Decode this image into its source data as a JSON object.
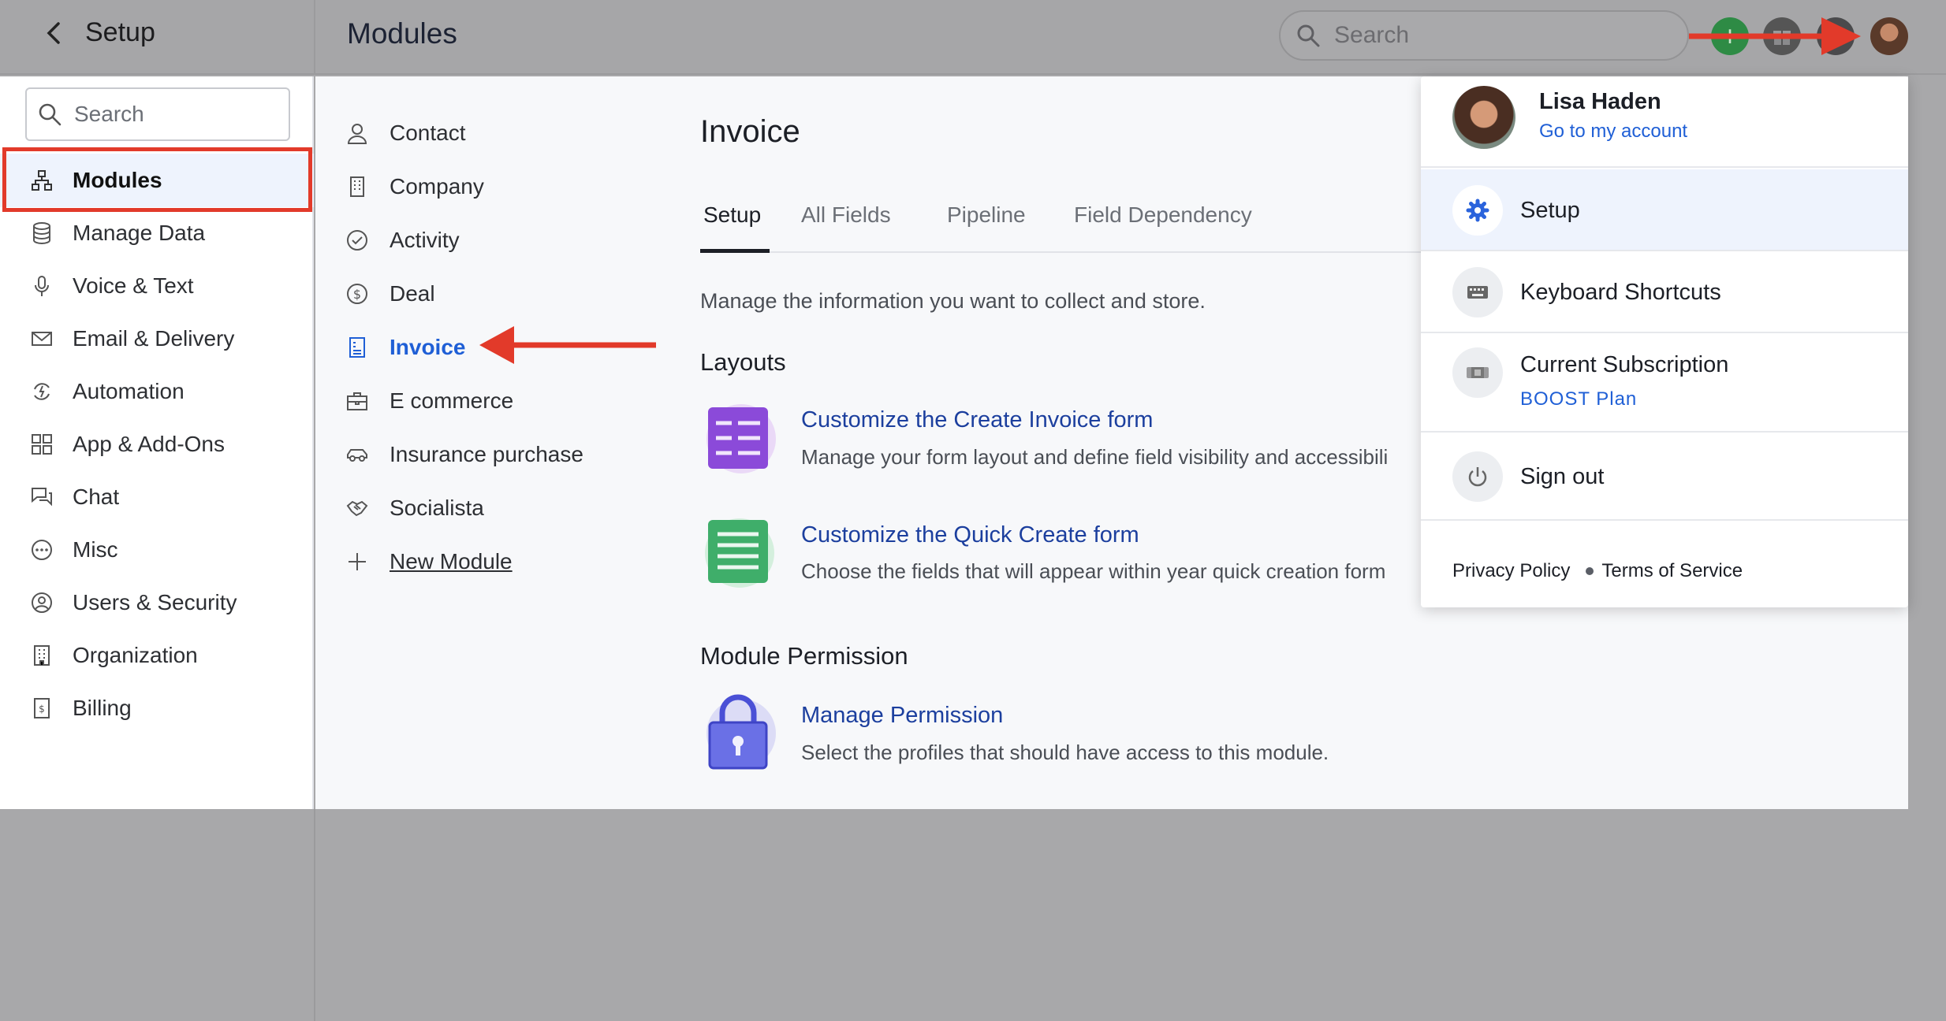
{
  "topbar": {
    "setup_title": "Setup",
    "modules_title": "Modules",
    "search_placeholder": "Search"
  },
  "sidebar": {
    "search_placeholder": "Search",
    "items": [
      {
        "label": "Modules",
        "icon": "sitemap-icon",
        "active": true
      },
      {
        "label": "Manage Data",
        "icon": "database-icon"
      },
      {
        "label": "Voice & Text",
        "icon": "microphone-icon"
      },
      {
        "label": "Email & Delivery",
        "icon": "envelope-icon"
      },
      {
        "label": "Automation",
        "icon": "automation-icon"
      },
      {
        "label": "App & Add-Ons",
        "icon": "grid-icon"
      },
      {
        "label": "Chat",
        "icon": "chat-icon"
      },
      {
        "label": "Misc",
        "icon": "ellipsis-icon"
      },
      {
        "label": "Users & Security",
        "icon": "user-circle-icon"
      },
      {
        "label": "Organization",
        "icon": "building-icon"
      },
      {
        "label": "Billing",
        "icon": "billing-icon"
      }
    ]
  },
  "modules": {
    "items": [
      {
        "label": "Contact",
        "icon": "person-icon"
      },
      {
        "label": "Company",
        "icon": "building-icon"
      },
      {
        "label": "Activity",
        "icon": "check-circle-icon"
      },
      {
        "label": "Deal",
        "icon": "dollar-circle-icon"
      },
      {
        "label": "Invoice",
        "icon": "invoice-icon",
        "active": true
      },
      {
        "label": "E commerce",
        "icon": "briefcase-icon"
      },
      {
        "label": "Insurance purchase",
        "icon": "car-icon"
      },
      {
        "label": "Socialista",
        "icon": "handshake-icon"
      }
    ],
    "new_module": "New Module"
  },
  "content": {
    "title": "Invoice",
    "tabs": [
      "Setup",
      "All Fields",
      "Pipeline",
      "Field Dependency"
    ],
    "active_tab": "Setup",
    "description": "Manage the information you want to collect and store.",
    "layouts_heading": "Layouts",
    "cards": [
      {
        "title": "Customize the Create Invoice form",
        "desc": "Manage your form layout and define field visibility and accessibili",
        "icon": "form-purple-icon"
      },
      {
        "title": "Customize the Quick Create form",
        "desc": "Choose the fields that will appear within year quick creation form",
        "icon": "form-green-icon"
      }
    ],
    "permission_heading": "Module Permission",
    "permission": {
      "title": "Manage Permission",
      "desc": "Select the profiles that should have access to this module.",
      "icon": "lock-icon"
    }
  },
  "dropdown": {
    "user_name": "Lisa Haden",
    "account_link": "Go to my account",
    "items": [
      {
        "label": "Setup",
        "icon": "gear-icon",
        "selected": true
      },
      {
        "label": "Keyboard Shortcuts",
        "icon": "keyboard-icon"
      },
      {
        "label": "Current Subscription",
        "sub": "BOOST Plan",
        "icon": "subscription-icon"
      },
      {
        "label": "Sign out",
        "icon": "power-icon"
      }
    ],
    "footer": {
      "privacy": "Privacy Policy",
      "terms": "Terms of Service"
    }
  },
  "colors": {
    "accent": "#1f5fd6",
    "highlight_box": "#e23a2a",
    "annotation_arrow": "#e23a2a",
    "add_button": "#2e8b45"
  }
}
